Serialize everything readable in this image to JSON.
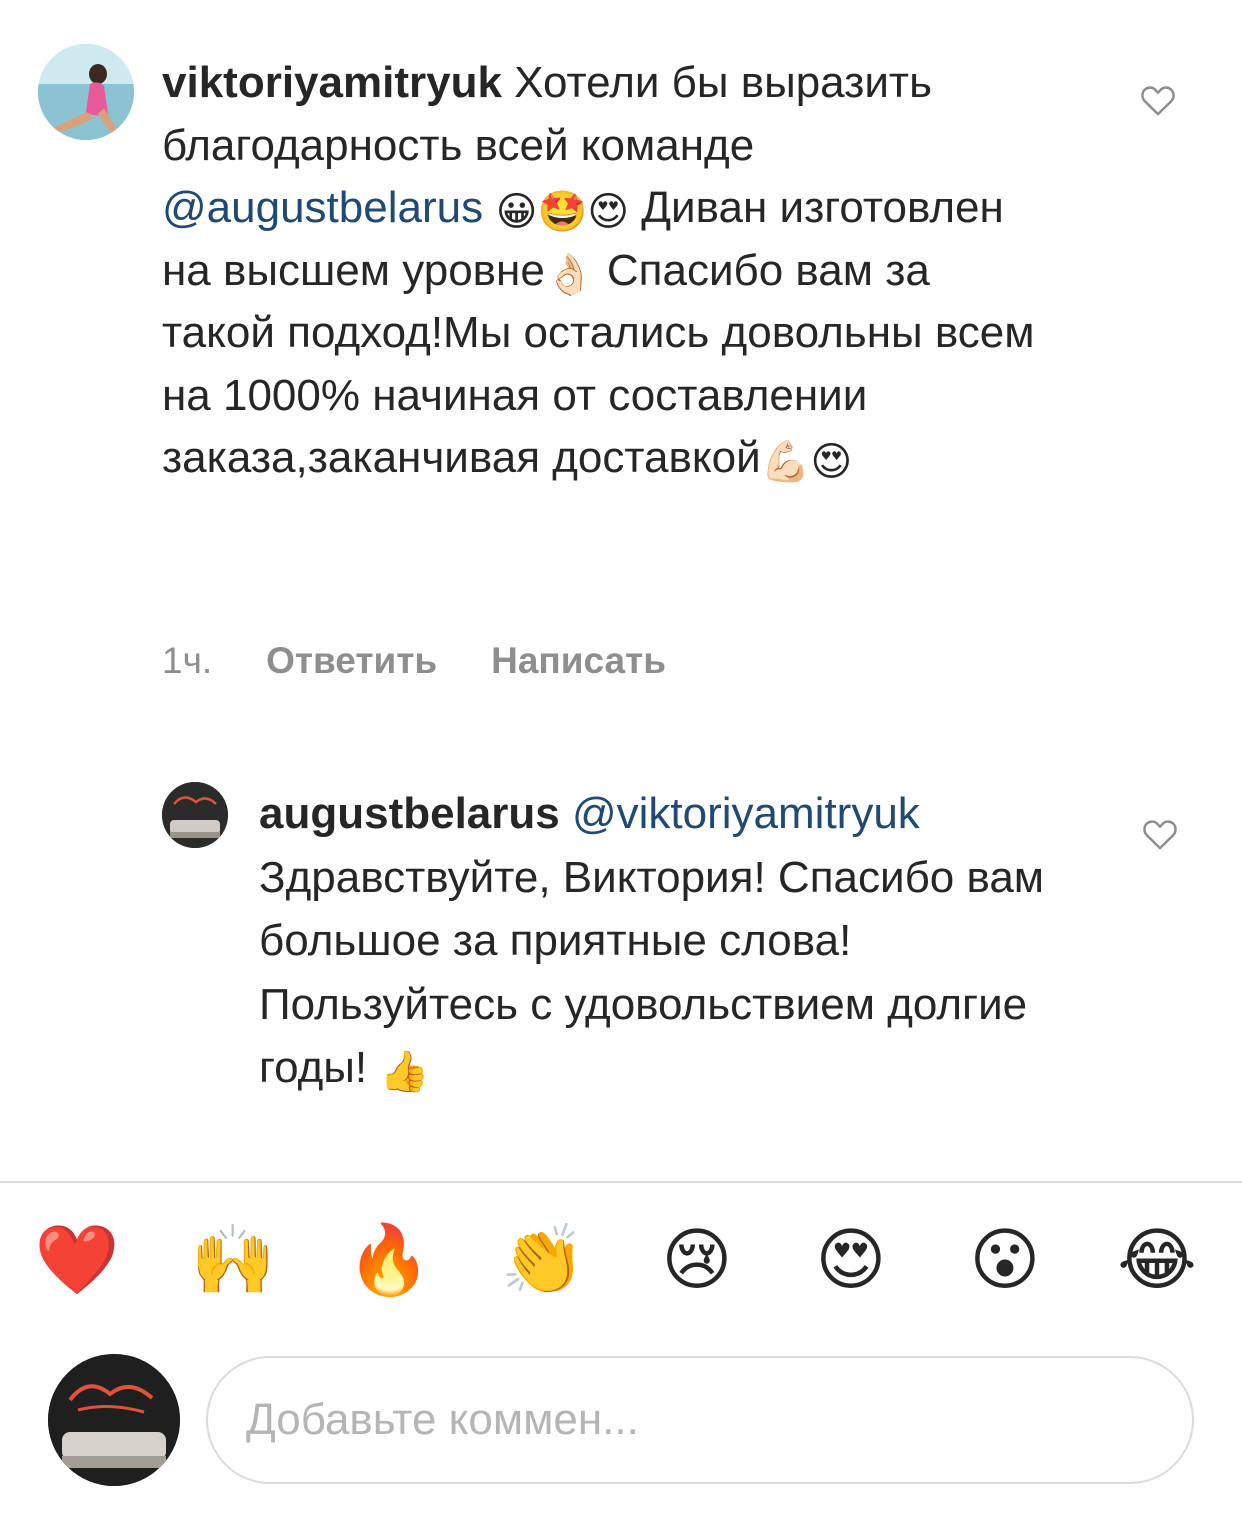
{
  "comments": [
    {
      "username": "viktoriyamitryuk",
      "text_part1": " Хотели бы выразить благодарность всей команде ",
      "mention": "@augustbelarus",
      "emoji_a": " 😀🤩😍",
      "text_part2": " Диван изготовлен на высшем уровне",
      "emoji_b": "👌🏻",
      "text_part3": " Спасибо вам за такой подход!Мы остались довольны всем на 1000% начиная от составлении заказа,заканчивая доставкой",
      "emoji_c": "💪🏻😍",
      "time": "1ч.",
      "reply_label": "Ответить",
      "message_label": "Написать"
    },
    {
      "username": "augustbelarus",
      "mention": " @viktoriyamitryuk",
      "text": "Здравствуйте, Виктория! Спасибо вам большое за приятные слова! Пользуйтесь с удовольствием долгие годы!",
      "emoji": " 👍"
    }
  ],
  "reactions": [
    {
      "icon": "heart",
      "glyph": "❤️"
    },
    {
      "icon": "raising-hands",
      "glyph": "🙌"
    },
    {
      "icon": "fire",
      "glyph": "🔥"
    },
    {
      "icon": "clapping-hands",
      "glyph": "👏"
    },
    {
      "icon": "crying-face",
      "glyph": "😢"
    },
    {
      "icon": "heart-eyes",
      "glyph": "😍"
    },
    {
      "icon": "surprised-face",
      "glyph": "😮"
    },
    {
      "icon": "tears-of-joy",
      "glyph": "😂"
    }
  ],
  "composer": {
    "placeholder": "Добавьте коммен..."
  },
  "colors": {
    "text": "#262626",
    "secondary": "#8e8e8e",
    "mention": "#1f4a75",
    "divider": "#dbdbdb"
  }
}
